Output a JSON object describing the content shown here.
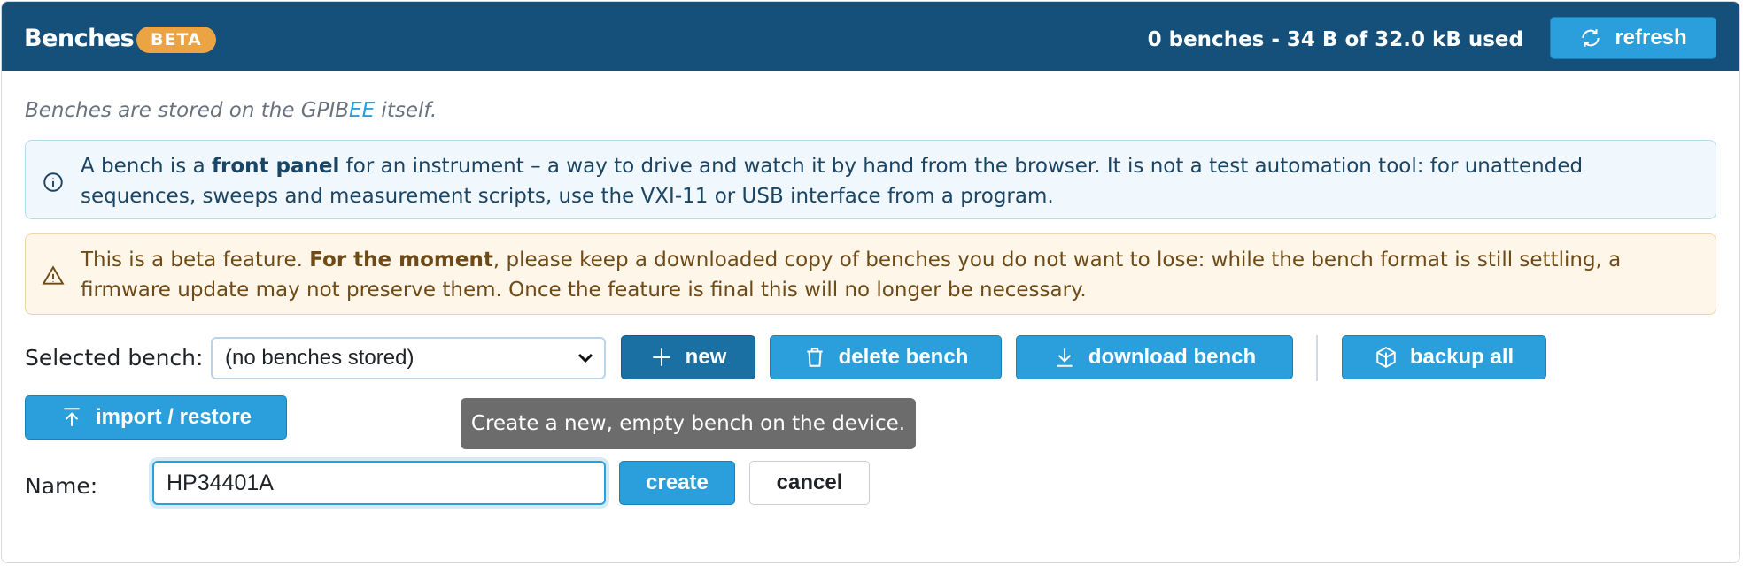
{
  "header": {
    "title": "Benches",
    "badge": "BETA",
    "usage": "0 benches - 34 B of 32.0 kB used",
    "refresh_label": "refresh"
  },
  "intro": {
    "prefix": "Benches are stored on the GPIB",
    "accent": "EE",
    "suffix": " itself."
  },
  "info_alert": {
    "text_before": "A bench is a ",
    "bold": "front panel",
    "text_after": " for an instrument – a way to drive and watch it by hand from the browser. It is not a test automation tool: for unattended sequences, sweeps and measurement scripts, use the VXI-11 or USB interface from a program."
  },
  "warning_alert": {
    "text_before": "This is a beta feature. ",
    "bold": "For the moment",
    "text_after": ", please keep a downloaded copy of benches you do not want to lose: while the bench format is still settling, a firmware update may not preserve them. Once the feature is final this will no longer be necessary."
  },
  "selector": {
    "label": "Selected bench:",
    "value": "(no benches stored)"
  },
  "toolbar": {
    "new_label": "new",
    "delete_label": "delete bench",
    "download_label": "download bench",
    "backup_label": "backup all",
    "import_label": "import / restore"
  },
  "tooltip": "Create a new, empty bench on the device.",
  "create_form": {
    "label": "Name:",
    "value": "HP34401A",
    "create_label": "create",
    "cancel_label": "cancel"
  },
  "colors": {
    "header": "#15507a",
    "accent": "#2a9fdc",
    "badge": "#eca442",
    "info_bg": "#f1f8fd",
    "warn_bg": "#fdf6e9"
  }
}
